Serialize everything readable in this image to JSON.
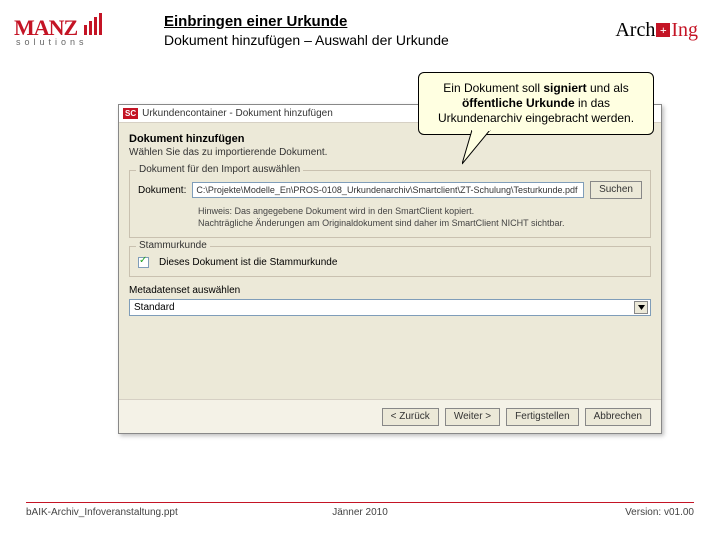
{
  "header": {
    "logo_left": {
      "name": "MANZ",
      "sub": "solutions"
    },
    "title": "Einbringen einer Urkunde",
    "subtitle": "Dokument hinzufügen – Auswahl der Urkunde",
    "logo_right": {
      "arch": "Arch",
      "plus": "+",
      "ing": "Ing"
    }
  },
  "callout": {
    "p1a": "Ein Dokument soll ",
    "p1b": "signiert",
    "p1c": " und als ",
    "p2a": "öffentliche Urkunde",
    "p2b": " in das Urkundenarchiv eingebracht werden."
  },
  "dialog": {
    "badge": "SC",
    "title": "Urkundencontainer - Dokument hinzufügen",
    "heading": "Dokument hinzufügen",
    "intro": "Wählen Sie das zu importierende Dokument.",
    "group_import": {
      "legend": "Dokument für den Import auswählen",
      "label": "Dokument:",
      "path": "C:\\Projekte\\Modelle_En\\PROS-0108_Urkundenarchiv\\Smartclient\\ZT-Schulung\\Testurkunde.pdf",
      "browse": "Suchen",
      "hint1": "Hinweis: Das angegebene Dokument wird in den SmartClient kopiert.",
      "hint2": "Nachträgliche Änderungen am Originaldokument sind daher im SmartClient NICHT sichtbar."
    },
    "group_stamm": {
      "legend": "Stammurkunde",
      "checkbox_label": "Dieses Dokument ist die Stammurkunde"
    },
    "group_set": {
      "legend": "Metadatenset auswählen",
      "value": "Standard"
    },
    "buttons": {
      "back": "< Zurück",
      "next": "Weiter >",
      "finish": "Fertigstellen",
      "cancel": "Abbrechen"
    }
  },
  "footer": {
    "left": "bAIK-Archiv_Infoveranstaltung.ppt",
    "center": "Jänner 2010",
    "right": "Version: v01.00"
  }
}
